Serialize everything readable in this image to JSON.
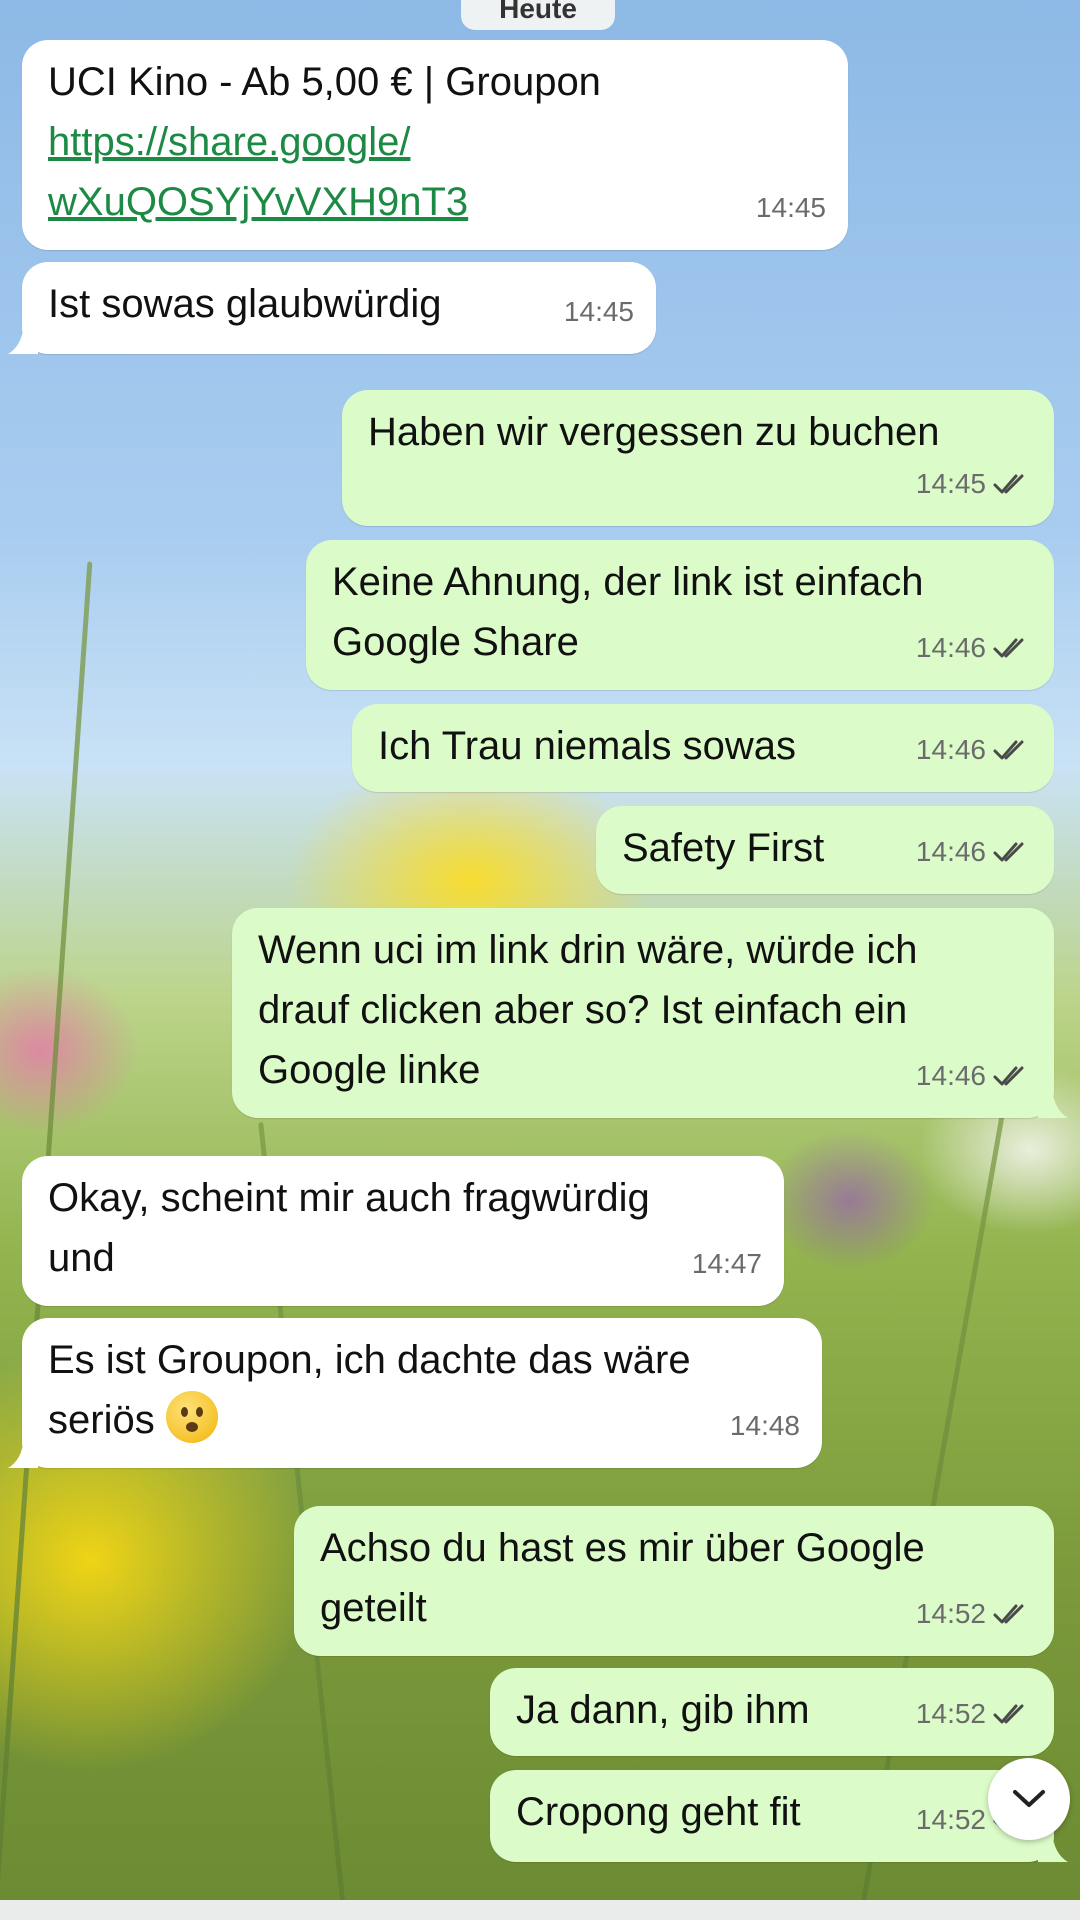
{
  "chat": {
    "date_label": "Heute",
    "messages": [
      {
        "dir": "in",
        "text": "UCI Kino - Ab 5,00 € | Groupon",
        "link": "https://share.google/\nwXuQOSYjYvVXH9nT3",
        "time": "14:45"
      },
      {
        "dir": "in",
        "text": "Ist sowas glaubwürdig",
        "time": "14:45"
      },
      {
        "dir": "out",
        "text": "Haben wir vergessen zu buchen",
        "time": "14:45",
        "read": true
      },
      {
        "dir": "out",
        "text": "Keine Ahnung, der link ist einfach\nGoogle Share",
        "time": "14:46",
        "read": true
      },
      {
        "dir": "out",
        "text": "Ich Trau niemals sowas",
        "time": "14:46",
        "read": true
      },
      {
        "dir": "out",
        "text": "Safety First",
        "time": "14:46",
        "read": true
      },
      {
        "dir": "out",
        "text": "Wenn uci im link drin wäre, würde ich\ndrauf clicken aber so? Ist einfach ein\nGoogle linke",
        "time": "14:46",
        "read": true
      },
      {
        "dir": "in",
        "text": "Okay, scheint mir auch fragwürdig\nund",
        "time": "14:47"
      },
      {
        "dir": "in",
        "text": "Es ist Groupon, ich dachte das wäre\nseriös",
        "emoji": "anguished-face-emoji",
        "time": "14:48"
      },
      {
        "dir": "out",
        "text": "Achso du hast es mir über Google\ngeteilt",
        "time": "14:52",
        "read": true
      },
      {
        "dir": "out",
        "text": "Ja dann, gib ihm",
        "time": "14:52",
        "read": true
      },
      {
        "dir": "out",
        "text": "Cropong geht fit",
        "time": "14:52",
        "read": true
      }
    ]
  },
  "scroll_button": {
    "icon": "chevron-down-icon"
  },
  "colors": {
    "incoming": "#ffffff",
    "outgoing": "#dbfcc8",
    "link": "#1c8a44",
    "read_ticks": "#4a4a4a"
  }
}
